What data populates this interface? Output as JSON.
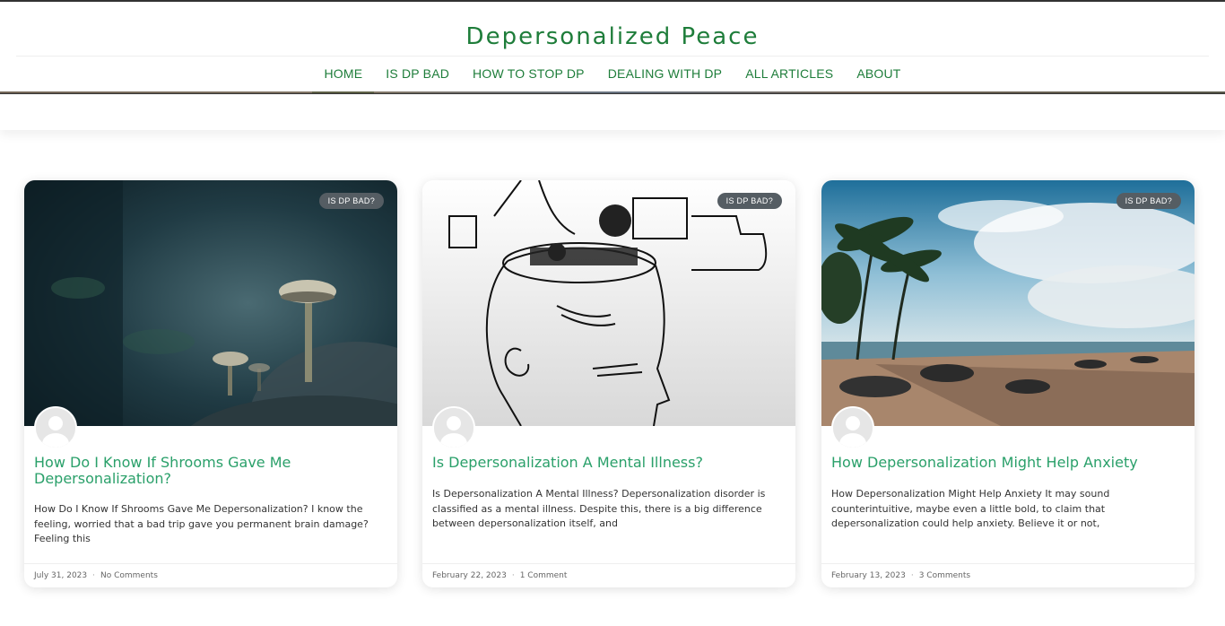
{
  "site": {
    "title": "Depersonalized Peace"
  },
  "nav": {
    "items": [
      {
        "label": "HOME",
        "active": true
      },
      {
        "label": "IS DP BAD",
        "active": false
      },
      {
        "label": "HOW TO STOP DP",
        "active": false
      },
      {
        "label": "DEALING WITH DP",
        "active": false
      },
      {
        "label": "ALL ARTICLES",
        "active": false
      },
      {
        "label": "ABOUT",
        "active": false
      }
    ]
  },
  "cards": [
    {
      "badge": "IS DP BAD?",
      "title": "How Do I Know If Shrooms Gave Me Depersonalization?",
      "excerpt": "How Do I Know If Shrooms Gave Me Depersonalization? I know the feeling, worried that a bad trip gave you permanent brain damage? Feeling this",
      "date": "July 31, 2023",
      "comments": "No Comments",
      "image": "mushroom-forest"
    },
    {
      "badge": "IS DP BAD?",
      "title": "Is Depersonalization A Mental Illness?",
      "excerpt": "Is Depersonalization A Mental Illness?   Depersonalization disorder is classified as a mental illness. Despite this, there is a big difference between depersonalization itself, and",
      "date": "February 22, 2023",
      "comments": "1 Comment",
      "image": "head-machinery-sketch"
    },
    {
      "badge": "IS DP BAD?",
      "title": "How Depersonalization Might Help Anxiety",
      "excerpt": "How Depersonalization Might Help Anxiety It may sound counterintuitive, maybe even a little bold, to claim that depersonalization could help anxiety. Believe it or not,",
      "date": "February 13, 2023",
      "comments": "3 Comments",
      "image": "beach-palms"
    }
  ],
  "colors": {
    "brand": "#1e7d3a",
    "link": "#2aa06a",
    "badge": "#555d63"
  }
}
